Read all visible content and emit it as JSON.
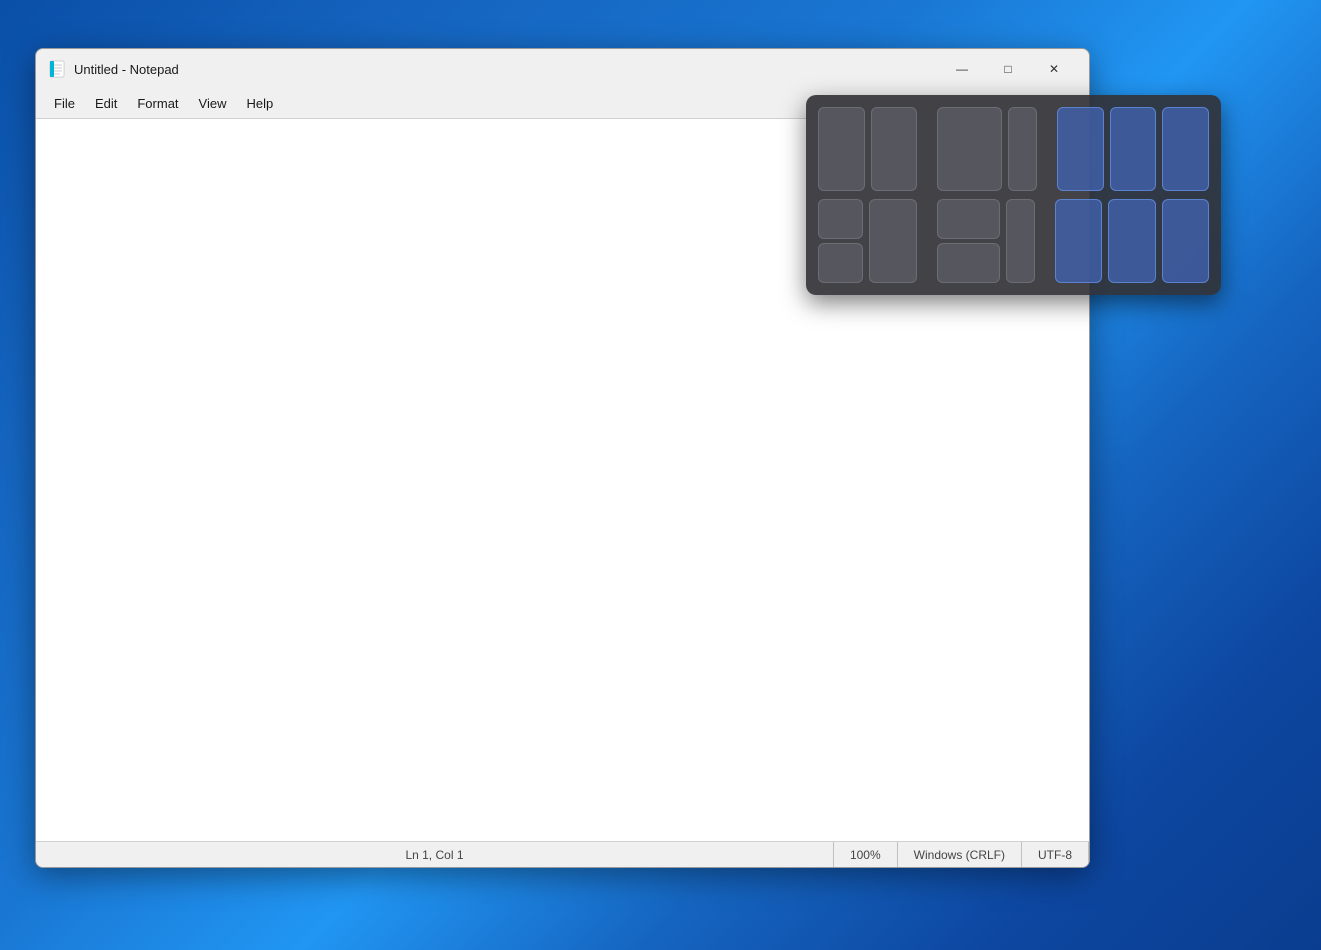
{
  "window": {
    "title": "Untitled - Notepad",
    "icon": "📝"
  },
  "titlebar": {
    "title": "Untitled - Notepad",
    "minimize_label": "—",
    "maximize_label": "□",
    "close_label": "✕"
  },
  "menubar": {
    "items": [
      "File",
      "Edit",
      "Format",
      "View",
      "Help"
    ]
  },
  "editor": {
    "content": "",
    "placeholder": ""
  },
  "statusbar": {
    "position": "Ln 1, Col 1",
    "zoom": "100%",
    "line_ending": "Windows (CRLF)",
    "encoding": "UTF-8"
  },
  "snap_overlay": {
    "visible": true,
    "rows": [
      {
        "cells": [
          {
            "id": "r1c1",
            "highlighted": false
          },
          {
            "id": "r1c2",
            "highlighted": false
          },
          {
            "id": "r1c3",
            "highlighted": false,
            "wide": true
          },
          {
            "id": "r1c4",
            "highlighted": false,
            "narrow": true
          },
          {
            "id": "r1c5",
            "highlighted": true
          },
          {
            "id": "r1c6",
            "highlighted": true
          },
          {
            "id": "r1c7",
            "highlighted": true
          }
        ]
      },
      {
        "cells": [
          {
            "id": "r2c1",
            "highlighted": false
          },
          {
            "id": "r2c2",
            "highlighted": false
          },
          {
            "id": "r2c3",
            "highlighted": false,
            "wide": true
          },
          {
            "id": "r2c4",
            "highlighted": false,
            "narrow": true
          },
          {
            "id": "r2c5",
            "highlighted": true
          },
          {
            "id": "r2c6",
            "highlighted": true
          },
          {
            "id": "r2c7",
            "highlighted": true
          }
        ]
      }
    ]
  },
  "colors": {
    "desktop_bg_start": "#0a4fa8",
    "desktop_bg_end": "#0a3d8f",
    "window_bg": "#f0f0f0",
    "editor_bg": "#ffffff",
    "snap_bg": "rgba(50,50,55,0.92)",
    "snap_cell_normal": "rgba(100,100,110,0.6)",
    "snap_cell_highlight": "rgba(65,100,180,0.75)",
    "accent": "#0078d4"
  }
}
